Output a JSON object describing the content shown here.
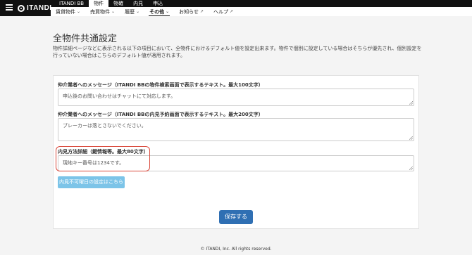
{
  "header": {
    "logo_text": "ITANDI",
    "main_tabs": [
      "ITANDI BB",
      "物件",
      "物確",
      "内見",
      "申込"
    ],
    "active_main_tab": "物件",
    "sub_nav": [
      {
        "label": "賃貸物件",
        "has_dropdown": true
      },
      {
        "label": "売買物件",
        "has_dropdown": true
      },
      {
        "label": "履歴",
        "has_dropdown": true
      },
      {
        "label": "その他",
        "has_dropdown": true,
        "active": true
      },
      {
        "label": "お知らせ",
        "external": true
      },
      {
        "label": "ヘルプ",
        "external": true
      }
    ]
  },
  "page": {
    "title": "全物件共通設定",
    "description": "物件詳細ページなどに表示される以下の項目において、全物件におけるデフォルト値を設定出来ます。物件で個別に設定している場合はそちらが優先され、個別設定を行っていない場合はこちらのデフォルト値が適用されます。"
  },
  "form": {
    "field1": {
      "label": "仲介業者へのメッセージ（ITANDI BBの物件検索画面で表示するテキスト。最大100文字）",
      "value": "申込後のお問い合わせはチャットにて対応します。"
    },
    "field2": {
      "label": "仲介業者へのメッセージ（ITANDI BBの内見予約画面で表示するテキスト。最大200文字）",
      "value": "ブレーカーは落とさないでください。"
    },
    "field3": {
      "label": "内見方法詳細（鍵情報等。最大80文字）",
      "value": "現地キー番号は1234です。"
    },
    "unavailable_days_button": "内見不可曜日の設定はこちら",
    "save_button": "保存する"
  },
  "footer": {
    "copyright": "© ITANDI, Inc. All rights reserved."
  },
  "colors": {
    "topbar": "#111111",
    "save_button": "#2f6fb3",
    "link_button": "#7cc4e8",
    "highlight": "#d9473a"
  }
}
